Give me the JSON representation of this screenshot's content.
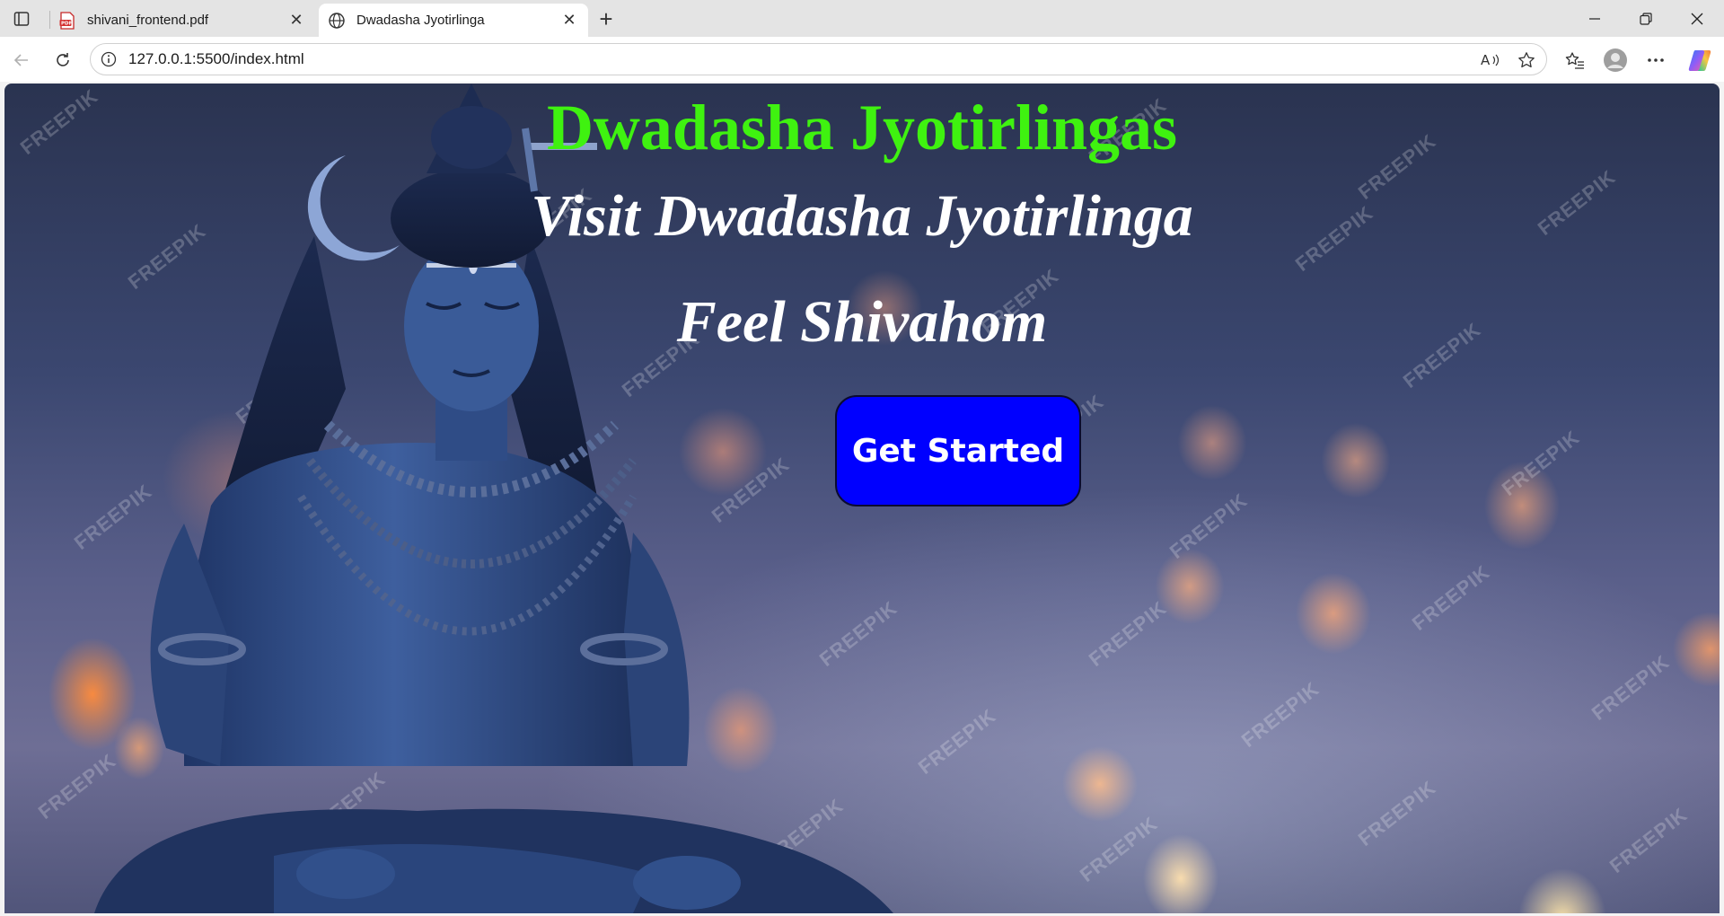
{
  "browser": {
    "tabs": [
      {
        "title": "shivani_frontend.pdf",
        "icon": "pdf-icon",
        "active": false
      },
      {
        "title": "Dwadasha Jyotirlinga",
        "icon": "globe-icon",
        "active": true
      }
    ],
    "new_tab_label": "+",
    "address": "127.0.0.1:5500/index.html",
    "accent_color": "#0000ff"
  },
  "page": {
    "title": "Dwadasha Jyotirlingas",
    "subtitle_1": "Visit Dwadasha Jyotirlinga",
    "subtitle_2": "Feel Shivahom",
    "cta_label": "Get Started",
    "title_color": "#3ff210",
    "watermark_text": "FREEPIK"
  }
}
